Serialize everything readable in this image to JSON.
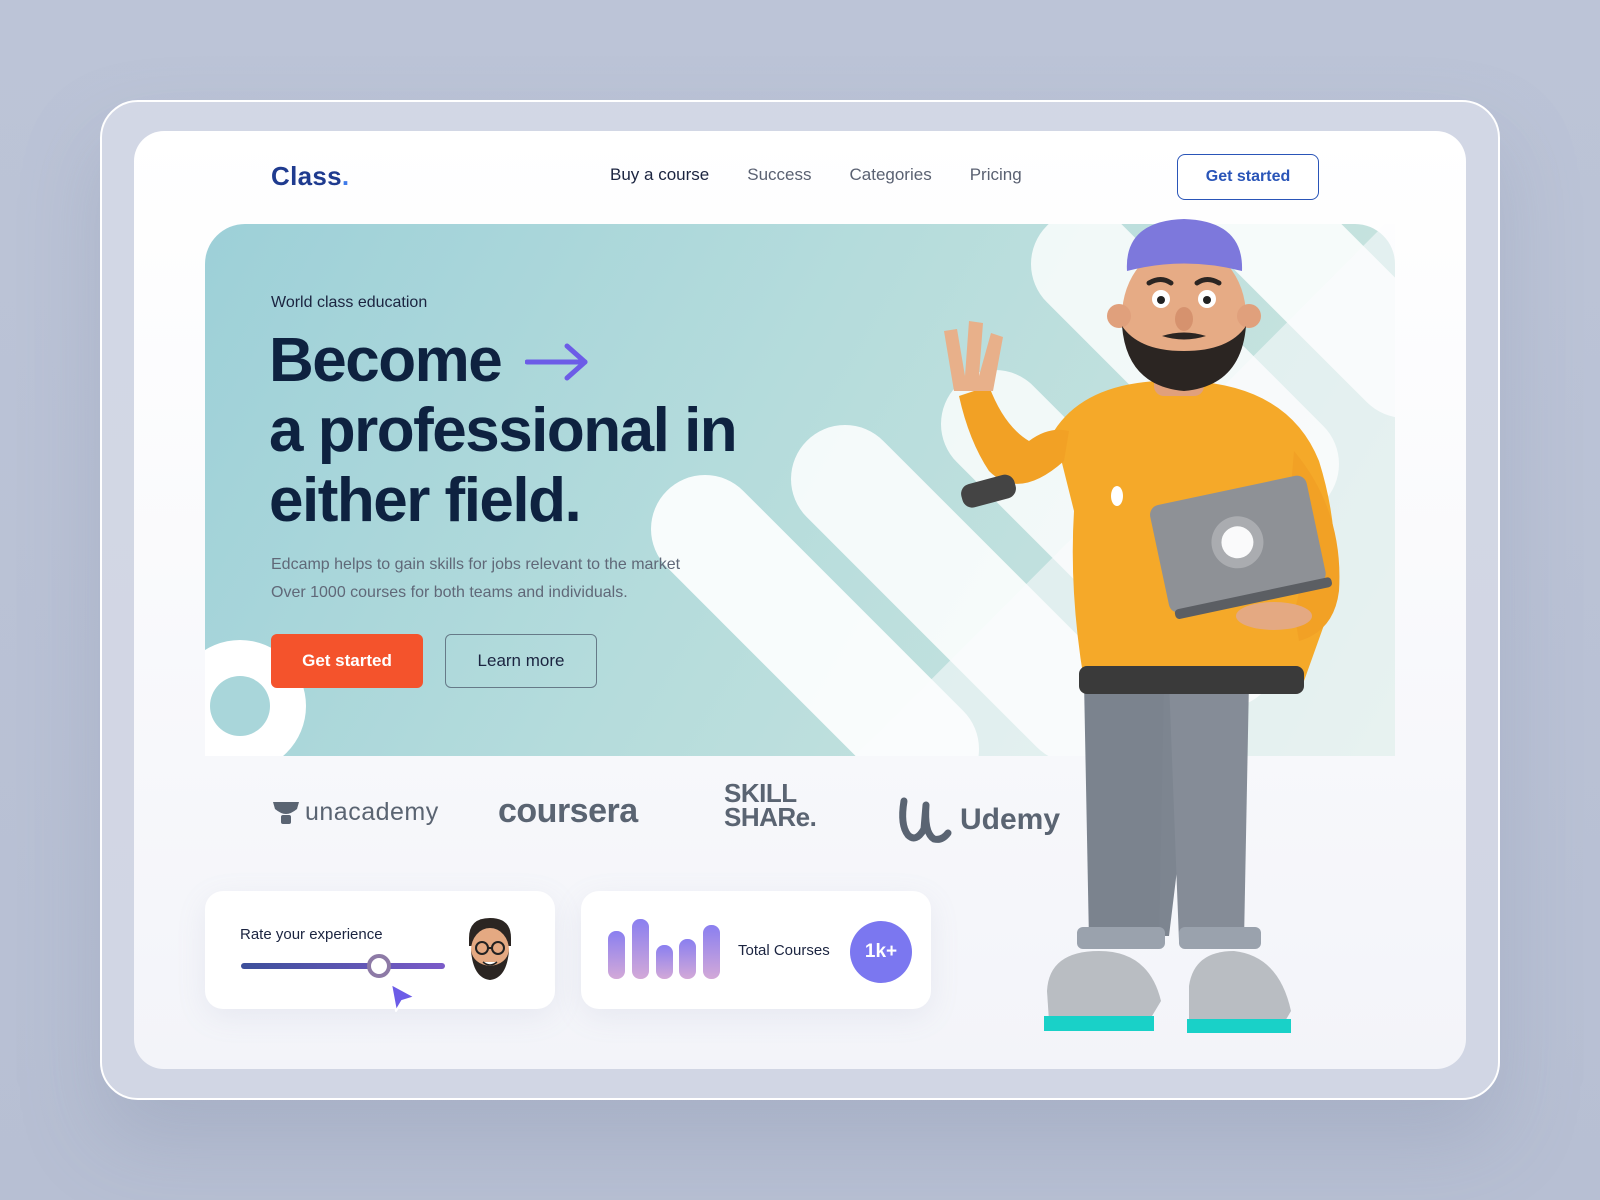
{
  "brand": {
    "logo_text": "Class",
    "logo_dot": "."
  },
  "nav": {
    "items": [
      {
        "label": "Buy a course",
        "active": true
      },
      {
        "label": "Success"
      },
      {
        "label": "Categories"
      },
      {
        "label": "Pricing"
      }
    ],
    "cta_label": "Get started"
  },
  "hero": {
    "eyebrow": "World class education",
    "headline_line1": "Become",
    "headline_line2": "a professional in",
    "headline_line3": "either field.",
    "desc_line1": "Edcamp helps to gain skills for jobs relevant to the market",
    "desc_line2": "Over 1000 courses for both teams and individuals.",
    "primary_button": "Get started",
    "secondary_button": "Learn more",
    "arrow_icon": "arrow-right-icon"
  },
  "partners": {
    "unacademy": "unacademy",
    "coursera": "coursera",
    "skillshare_line1": "SKILL",
    "skillshare_line2": "SHARe.",
    "udemy": "Udemy"
  },
  "cards": {
    "rate_label": "Rate your experience",
    "rate_value": 0.65,
    "total_label": "Total Courses",
    "total_value": "1k+"
  },
  "colors": {
    "brand_blue": "#2a55b8",
    "primary_orange": "#f4532c",
    "badge_purple": "#7b77f0",
    "hero_teal": "#a9d6da",
    "headline_navy": "#0e2240"
  }
}
